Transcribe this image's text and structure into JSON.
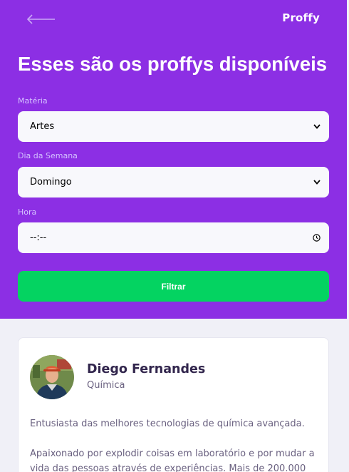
{
  "header": {
    "back_icon": "arrow-left-icon",
    "logo": "Proffy",
    "title": "Esses são os proffys disponíveis"
  },
  "form": {
    "subject": {
      "label": "Matéria",
      "value": "Artes",
      "icon": "chevron-down-icon"
    },
    "weekday": {
      "label": "Dia da Semana",
      "value": "Domingo",
      "icon": "chevron-down-icon"
    },
    "time": {
      "label": "Hora",
      "value": "--:--",
      "icon": "clock-icon"
    },
    "submit_label": "Filtrar"
  },
  "teacher": {
    "name": "Diego Fernandes",
    "subject": "Química",
    "bio_1": "Entusiasta das melhores tecnologias de química avançada.",
    "bio_2": "Apaixonado por explodir coisas em laboratório e por mudar a vida das pessoas através de experiências. Mais de 200.000"
  },
  "colors": {
    "primary": "#8c2fe4",
    "accent_green": "#04d361",
    "background": "#f0f0f7",
    "title_text": "#32264d",
    "body_text": "#6a6180"
  }
}
